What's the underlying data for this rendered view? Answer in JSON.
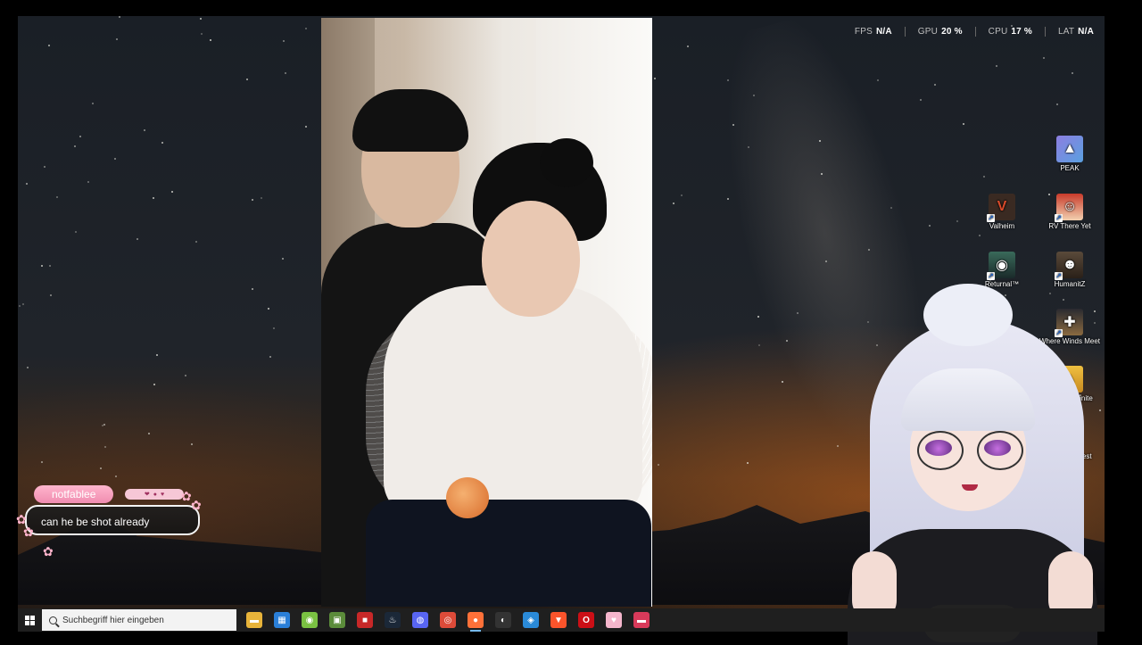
{
  "performance": {
    "items": [
      {
        "key": "FPS",
        "value": "N/A"
      },
      {
        "key": "GPU",
        "value": "20 %"
      },
      {
        "key": "CPU",
        "value": "17 %"
      },
      {
        "key": "LAT",
        "value": "N/A"
      }
    ]
  },
  "desktop_icons": [
    {
      "label": "PEAK",
      "icon": "peak-game-icon",
      "color": "#7b6fd0"
    },
    {
      "label": "Valheim",
      "icon": "valheim-game-icon",
      "color": "#3a2a22"
    },
    {
      "label": "RV There Yet",
      "icon": "rv-there-yet-game-icon",
      "color": "#c83a2a"
    },
    {
      "label": "Returnal™",
      "icon": "returnal-game-icon",
      "color": "#2a4a44"
    },
    {
      "label": "HumanitZ",
      "icon": "humanitz-game-icon",
      "color": "#4a3a2a"
    },
    {
      "label": "Where Winds Meet",
      "icon": "where-winds-meet-game-icon",
      "color": "#8a6a40"
    },
    {
      "label": "rchlight Infinite",
      "icon": "torchlight-infinite-game-icon",
      "color": "#d8a030"
    },
    {
      "label": "Of The Forest",
      "icon": "forest-game-icon",
      "color": "#2a2a2a"
    }
  ],
  "chat": {
    "username": "notfablee",
    "message": "can he be shot already",
    "badges": [
      "heart-badge",
      "dot-badge",
      "heart-badge"
    ]
  },
  "taskbar": {
    "search_placeholder": "Suchbegriff hier eingeben",
    "apps": [
      {
        "name": "file-explorer-icon",
        "color": "#e8b43a",
        "glyph": "▬"
      },
      {
        "name": "store-icon",
        "color": "#2a7fd8",
        "glyph": "▦"
      },
      {
        "name": "android-icon",
        "color": "#7ac142",
        "glyph": "◉"
      },
      {
        "name": "minecraft-icon",
        "color": "#5b8c3a",
        "glyph": "▣"
      },
      {
        "name": "recorder-icon",
        "color": "#c82828",
        "glyph": "■"
      },
      {
        "name": "steam-icon",
        "color": "#1b2838",
        "glyph": "♨"
      },
      {
        "name": "discord-icon",
        "color": "#5865f2",
        "glyph": "◍"
      },
      {
        "name": "chrome-icon",
        "color": "#dd4b39",
        "glyph": "◎"
      },
      {
        "name": "firefox-icon",
        "color": "#ff7139",
        "glyph": "●",
        "active": true
      },
      {
        "name": "obs-icon",
        "color": "#333333",
        "glyph": "◐"
      },
      {
        "name": "app-blue-icon",
        "color": "#2a8ad8",
        "glyph": "◈"
      },
      {
        "name": "brave-icon",
        "color": "#fb542b",
        "glyph": "▼"
      },
      {
        "name": "opera-icon",
        "color": "#cc0f16",
        "glyph": "O"
      },
      {
        "name": "app-pink-icon",
        "color": "#f5b6cc",
        "glyph": "♥"
      },
      {
        "name": "app-red-icon",
        "color": "#d83a5a",
        "glyph": "▬"
      }
    ]
  }
}
